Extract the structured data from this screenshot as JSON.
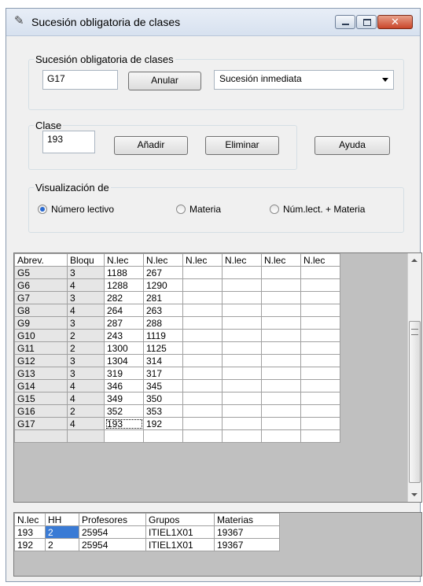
{
  "window": {
    "title": "Sucesión obligatoria de clases"
  },
  "group_sucesion": {
    "legend": "Sucesión obligatoria de clases",
    "code_value": "G17",
    "anular_label": "Anular",
    "select_value": "Sucesión inmediata"
  },
  "group_clase": {
    "legend": "Clase",
    "clase_value": "193",
    "anadir_label": "Añadir",
    "eliminar_label": "Eliminar"
  },
  "ayuda_label": "Ayuda",
  "group_visualizacion": {
    "legend": "Visualización de",
    "options": [
      {
        "label": "Número lectivo",
        "selected": true
      },
      {
        "label": "Materia",
        "selected": false
      },
      {
        "label": "Núm.lect. + Materia",
        "selected": false
      }
    ]
  },
  "grid1": {
    "headers": [
      "Abrev.",
      "Bloqu",
      "N.lec",
      "N.lec",
      "N.lec",
      "N.lec",
      "N.lec",
      "N.lec"
    ],
    "rows": [
      [
        "G5",
        "3",
        "1188",
        "267",
        "",
        "",
        "",
        ""
      ],
      [
        "G6",
        "4",
        "1288",
        "1290",
        "",
        "",
        "",
        ""
      ],
      [
        "G7",
        "3",
        "282",
        "281",
        "",
        "",
        "",
        ""
      ],
      [
        "G8",
        "4",
        "264",
        "263",
        "",
        "",
        "",
        ""
      ],
      [
        "G9",
        "3",
        "287",
        "288",
        "",
        "",
        "",
        ""
      ],
      [
        "G10",
        "2",
        "243",
        "1119",
        "",
        "",
        "",
        ""
      ],
      [
        "G11",
        "2",
        "1300",
        "1125",
        "",
        "",
        "",
        ""
      ],
      [
        "G12",
        "3",
        "1304",
        "314",
        "",
        "",
        "",
        ""
      ],
      [
        "G13",
        "3",
        "319",
        "317",
        "",
        "",
        "",
        ""
      ],
      [
        "G14",
        "4",
        "346",
        "345",
        "",
        "",
        "",
        ""
      ],
      [
        "G15",
        "4",
        "349",
        "350",
        "",
        "",
        "",
        ""
      ],
      [
        "G16",
        "2",
        "352",
        "353",
        "",
        "",
        "",
        ""
      ],
      [
        "G17",
        "4",
        "193",
        "192",
        "",
        "",
        "",
        ""
      ],
      [
        "",
        "",
        "",
        "",
        "",
        "",
        "",
        ""
      ]
    ]
  },
  "grid2": {
    "headers": [
      "N.lec",
      "HH",
      "Profesores",
      "Grupos",
      "Materias"
    ],
    "rows": [
      [
        "193",
        "2",
        "25954",
        "ITIEL1X01",
        "19367"
      ],
      [
        "192",
        "2",
        "25954",
        "ITIEL1X01",
        "19367"
      ]
    ]
  }
}
